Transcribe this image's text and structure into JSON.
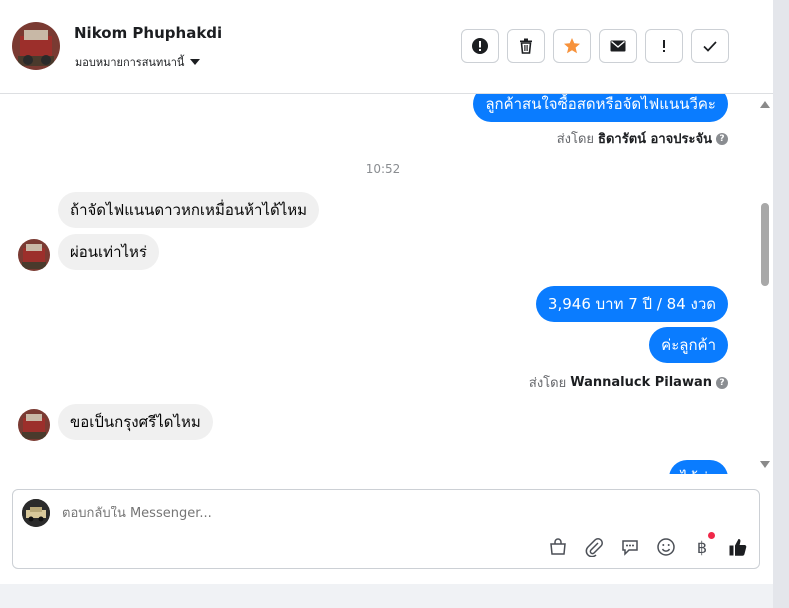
{
  "header": {
    "contact_name": "Nikom Phuphakdi",
    "assign_label": "มอบหมายการสนทนานี้",
    "actions": [
      {
        "name": "report-spam-button",
        "icon": "alert-circle-icon"
      },
      {
        "name": "delete-button",
        "icon": "trash-icon"
      },
      {
        "name": "star-button",
        "icon": "star-icon"
      },
      {
        "name": "mark-unread-button",
        "icon": "envelope-icon"
      },
      {
        "name": "mark-important-button",
        "icon": "exclamation-icon"
      },
      {
        "name": "mark-done-button",
        "icon": "check-icon"
      }
    ],
    "star_color": "#f7923b"
  },
  "thread": {
    "messages": [
      {
        "dir": "out",
        "text": "ลูกค้าสนใจซื้อสดหรือจัดไฟแนนวีคะ"
      },
      {
        "dir": "meta",
        "sent_by_prefix": "ส่งโดย",
        "sent_by_name": "ธิดารัตน์ อาจประจัน"
      },
      {
        "dir": "time",
        "text": "10:52"
      },
      {
        "dir": "in",
        "text": "ถ้าจัดไฟแนนดาวหกเหมื่อนห้าได้ไหม"
      },
      {
        "dir": "in",
        "text": "ผ่อนเท่าไหร่"
      },
      {
        "dir": "out",
        "text": "3,946 บาท 7 ปี / 84 งวด"
      },
      {
        "dir": "out",
        "text": "ค่ะลูกค้า"
      },
      {
        "dir": "meta",
        "sent_by_prefix": "ส่งโดย",
        "sent_by_name": "Wannaluck Pilawan"
      },
      {
        "dir": "in",
        "text": "ขอเป็นกรุงศรีไดไหม"
      },
      {
        "dir": "out",
        "text": "ได้ค่ะ"
      }
    ]
  },
  "composer": {
    "placeholder": "ตอบกลับใน Messenger...",
    "tools": [
      "bag-icon",
      "paperclip-icon",
      "chat-bubble-icon",
      "smiley-icon",
      "baht-icon",
      "thumbs-up-icon"
    ],
    "baht_symbol": "฿"
  },
  "colors": {
    "outgoing_bubble": "#0a7cff",
    "incoming_bubble": "#f0f0f0",
    "notification_dot": "#f02849"
  }
}
